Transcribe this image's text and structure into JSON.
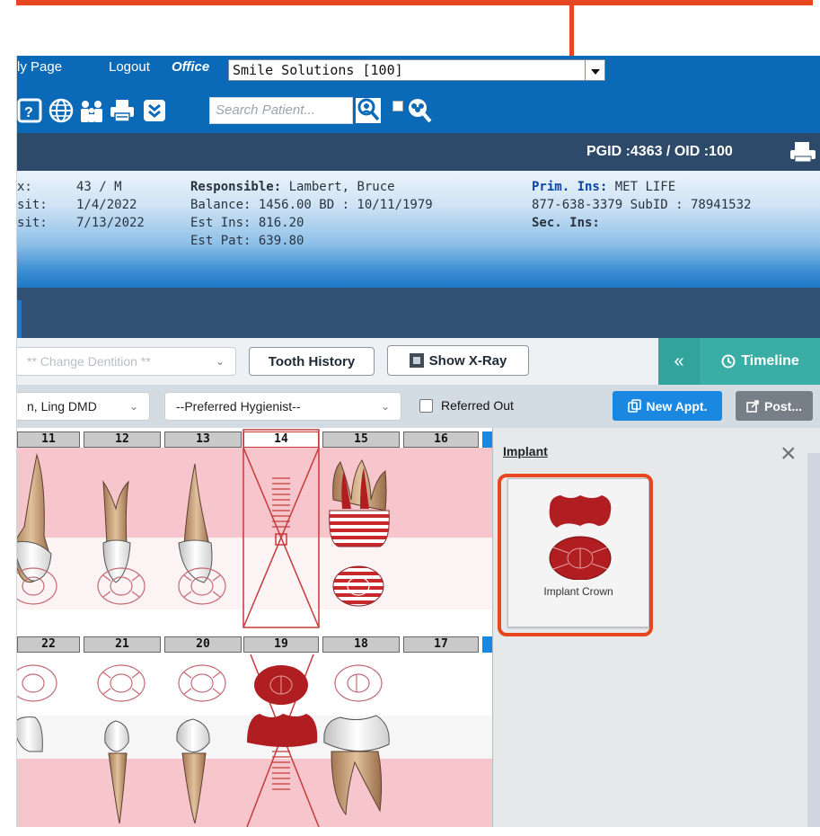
{
  "topbar": {
    "links": [
      "ly Page",
      "Logout"
    ],
    "office_label": "Office",
    "office_value": "Smile Solutions [100]",
    "search_placeholder": "Search Patient..."
  },
  "header": {
    "pgid": "PGID :4363 / OID :100"
  },
  "patient": {
    "labels": [
      "x:",
      "sit:",
      "sit:"
    ],
    "values": [
      "43 / M",
      "1/4/2022",
      "7/13/2022"
    ],
    "responsible_label": "Responsible:",
    "responsible_value": "Lambert, Bruce",
    "balance": "Balance: 1456.00   BD : 10/11/1979",
    "est_ins": "Est Ins: 816.20",
    "est_pat": "Est Pat: 639.80",
    "prim_ins_label": "Prim. Ins:",
    "prim_ins_value": "MET LIFE",
    "phone_subid": "877-638-3379 SubID : 78941532",
    "sec_ins_label": "Sec. Ins:"
  },
  "toolbar": {
    "dentition": "** Change Dentition **",
    "tooth_history": "Tooth History",
    "show_xray": "Show X-Ray",
    "collapse": "«",
    "timeline": "Timeline"
  },
  "toolbar2": {
    "provider": "n, Ling DMD",
    "hygienist": "--Preferred Hygienist--",
    "referred_out": "Referred Out",
    "new_appt": "New Appt.",
    "post": "Post..."
  },
  "chart": {
    "upper_numbers": [
      "11",
      "12",
      "13",
      "14",
      "15",
      "16"
    ],
    "lower_numbers": [
      "22",
      "21",
      "20",
      "19",
      "18",
      "17"
    ]
  },
  "panel": {
    "title": "Implant",
    "card_label": "Implant Crown"
  },
  "colors": {
    "annotation": "#e8461e",
    "topbar": "#0a6ab7",
    "implant_red": "#b01e22",
    "tooth_pink_band": "#f7c5cc"
  }
}
